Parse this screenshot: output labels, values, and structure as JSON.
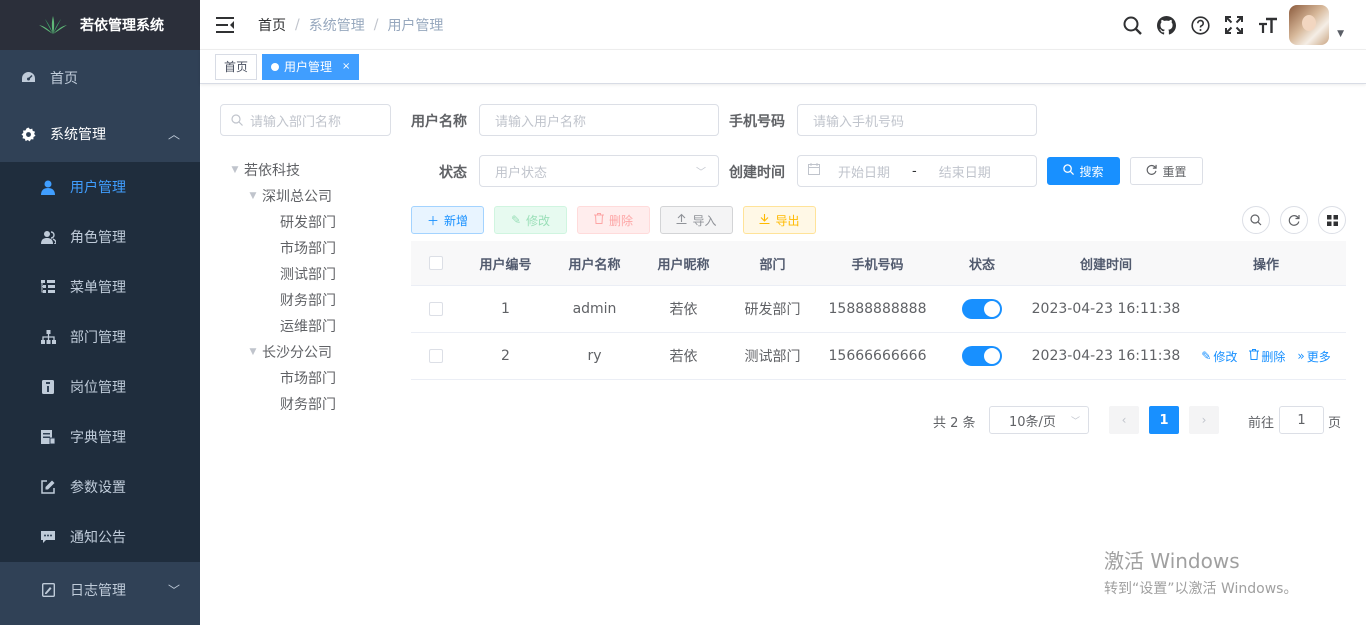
{
  "app": {
    "title": "若依管理系统"
  },
  "sidebar": {
    "home": "首页",
    "system": "系统管理",
    "items": [
      {
        "label": "用户管理",
        "icon": "user-icon",
        "active": true
      },
      {
        "label": "角色管理",
        "icon": "peoples-icon"
      },
      {
        "label": "菜单管理",
        "icon": "tree-table-icon"
      },
      {
        "label": "部门管理",
        "icon": "tree-icon"
      },
      {
        "label": "岗位管理",
        "icon": "post-icon"
      },
      {
        "label": "字典管理",
        "icon": "dict-icon"
      },
      {
        "label": "参数设置",
        "icon": "edit-icon"
      },
      {
        "label": "通知公告",
        "icon": "message-icon"
      }
    ],
    "log": "日志管理"
  },
  "navbar": {
    "breadcrumb": [
      "首页",
      "系统管理",
      "用户管理"
    ],
    "icons": [
      "search-icon",
      "github-icon",
      "question-icon",
      "fullscreen-icon",
      "size-icon"
    ]
  },
  "tags": [
    {
      "label": "首页",
      "active": false
    },
    {
      "label": "用户管理",
      "active": true,
      "close": "×"
    }
  ],
  "dept": {
    "placeholder": "请输入部门名称",
    "tree": {
      "root": "若依科技",
      "branch1": "深圳总公司",
      "branch1_children": [
        "研发部门",
        "市场部门",
        "测试部门",
        "财务部门",
        "运维部门"
      ],
      "branch2": "长沙分公司",
      "branch2_children": [
        "市场部门",
        "财务部门"
      ]
    }
  },
  "query": {
    "username_label": "用户名称",
    "username_placeholder": "请输入用户名称",
    "phone_label": "手机号码",
    "phone_placeholder": "请输入手机号码",
    "status_label": "状态",
    "status_placeholder": "用户状态",
    "time_label": "创建时间",
    "start_placeholder": "开始日期",
    "range_sep": "-",
    "end_placeholder": "结束日期",
    "search": "搜索",
    "reset": "重置"
  },
  "toolbar": {
    "add": "新增",
    "edit": "修改",
    "delete": "删除",
    "import": "导入",
    "export": "导出"
  },
  "table": {
    "headers": [
      "用户编号",
      "用户名称",
      "用户昵称",
      "部门",
      "手机号码",
      "状态",
      "创建时间",
      "操作"
    ],
    "rows": [
      {
        "id": "1",
        "username": "admin",
        "nickname": "若依",
        "dept": "研发部门",
        "phone": "15888888888",
        "status_on": true,
        "created": "2023-04-23 16:11:38",
        "ops": []
      },
      {
        "id": "2",
        "username": "ry",
        "nickname": "若依",
        "dept": "测试部门",
        "phone": "15666666666",
        "status_on": true,
        "created": "2023-04-23 16:11:38",
        "ops": [
          "修改",
          "删除",
          "更多"
        ]
      }
    ]
  },
  "pagination": {
    "total": "共 2 条",
    "page_size": "10条/页",
    "current": "1",
    "goto": "前往",
    "goto_value": "1",
    "page_suffix": "页"
  },
  "watermark": {
    "line1": "激活 Windows",
    "line2": "转到“设置”以激活 Windows。"
  },
  "colors": {
    "primary": "#1890ff",
    "sidebar": "#304156",
    "submenu": "#1f2d3d",
    "active_menu": "#409eff"
  }
}
